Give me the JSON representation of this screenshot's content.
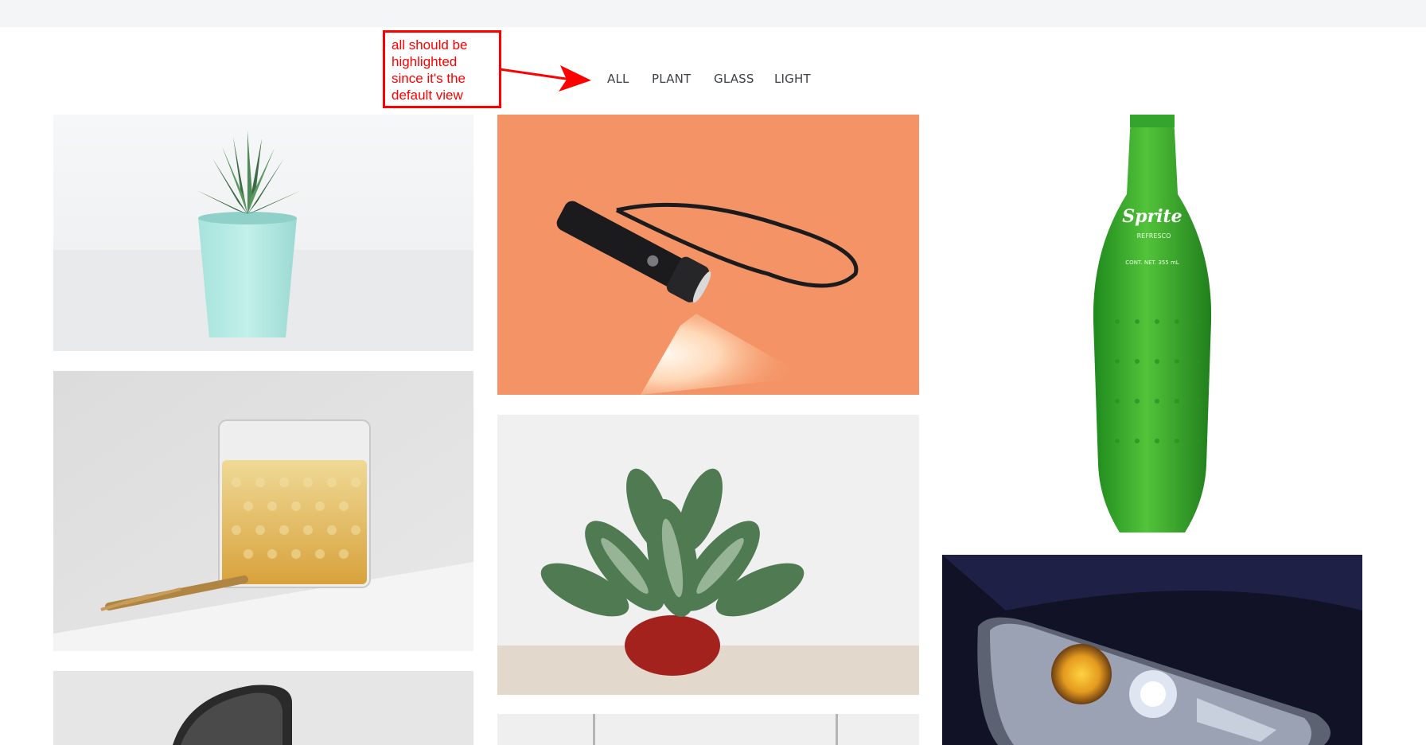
{
  "filters": [
    "ALL",
    "PLANT",
    "GLASS",
    "LIGHT"
  ],
  "annotation": {
    "lines": [
      "all should be",
      "highlighted",
      "since it's the",
      "default view"
    ]
  },
  "bottle_text": {
    "brand": "Sprite",
    "subtitle": "REFRESCO",
    "volume": "CONT. NET. 355 mL"
  },
  "colors": {
    "annotation": "#ff0000",
    "filter_text": "#3d4148",
    "topbar": "#f4f5f7"
  }
}
